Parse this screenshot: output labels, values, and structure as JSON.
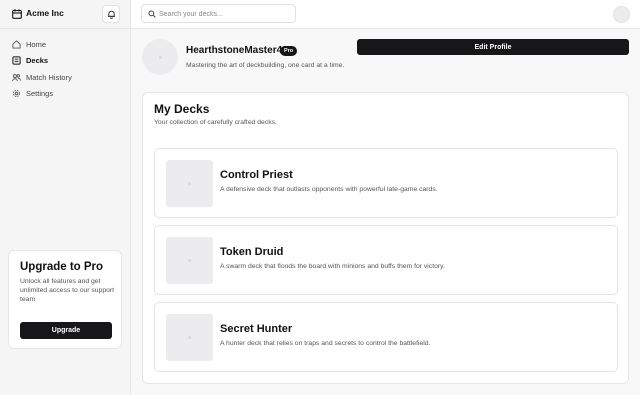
{
  "brand": {
    "name": "Acme Inc"
  },
  "sidebar": {
    "items": [
      {
        "label": "Home",
        "icon": "home-icon"
      },
      {
        "label": "Decks",
        "icon": "decks-icon",
        "active": true
      },
      {
        "label": "Match History",
        "icon": "history-icon"
      },
      {
        "label": "Settings",
        "icon": "gear-icon"
      }
    ],
    "upgrade": {
      "title": "Upgrade to Pro",
      "text": "Unlock all features and get unlimited access to our support team",
      "button_label": "Upgrade"
    }
  },
  "search": {
    "placeholder": "Search your decks..."
  },
  "profile": {
    "username": "HearthstoneMaster42",
    "badge": "Pro",
    "bio": "Mastering the art of deckbuilding, one card at a time.",
    "edit_label": "Edit Profile"
  },
  "decks": {
    "title": "My Decks",
    "subtitle": "Your collection of carefully crafted decks.",
    "items": [
      {
        "name": "Control Priest",
        "description": "A defensive deck that outlasts opponents with powerful late-game cards."
      },
      {
        "name": "Token Druid",
        "description": "A swarm deck that floods the board with minions and buffs them for victory."
      },
      {
        "name": "Secret Hunter",
        "description": "A hunter deck that relies on traps and secrets to control the battlefield."
      }
    ]
  },
  "colors": {
    "primary": "#17171a",
    "sidebar_bg": "#f5f5f6",
    "main_bg": "#f8f8f9"
  }
}
